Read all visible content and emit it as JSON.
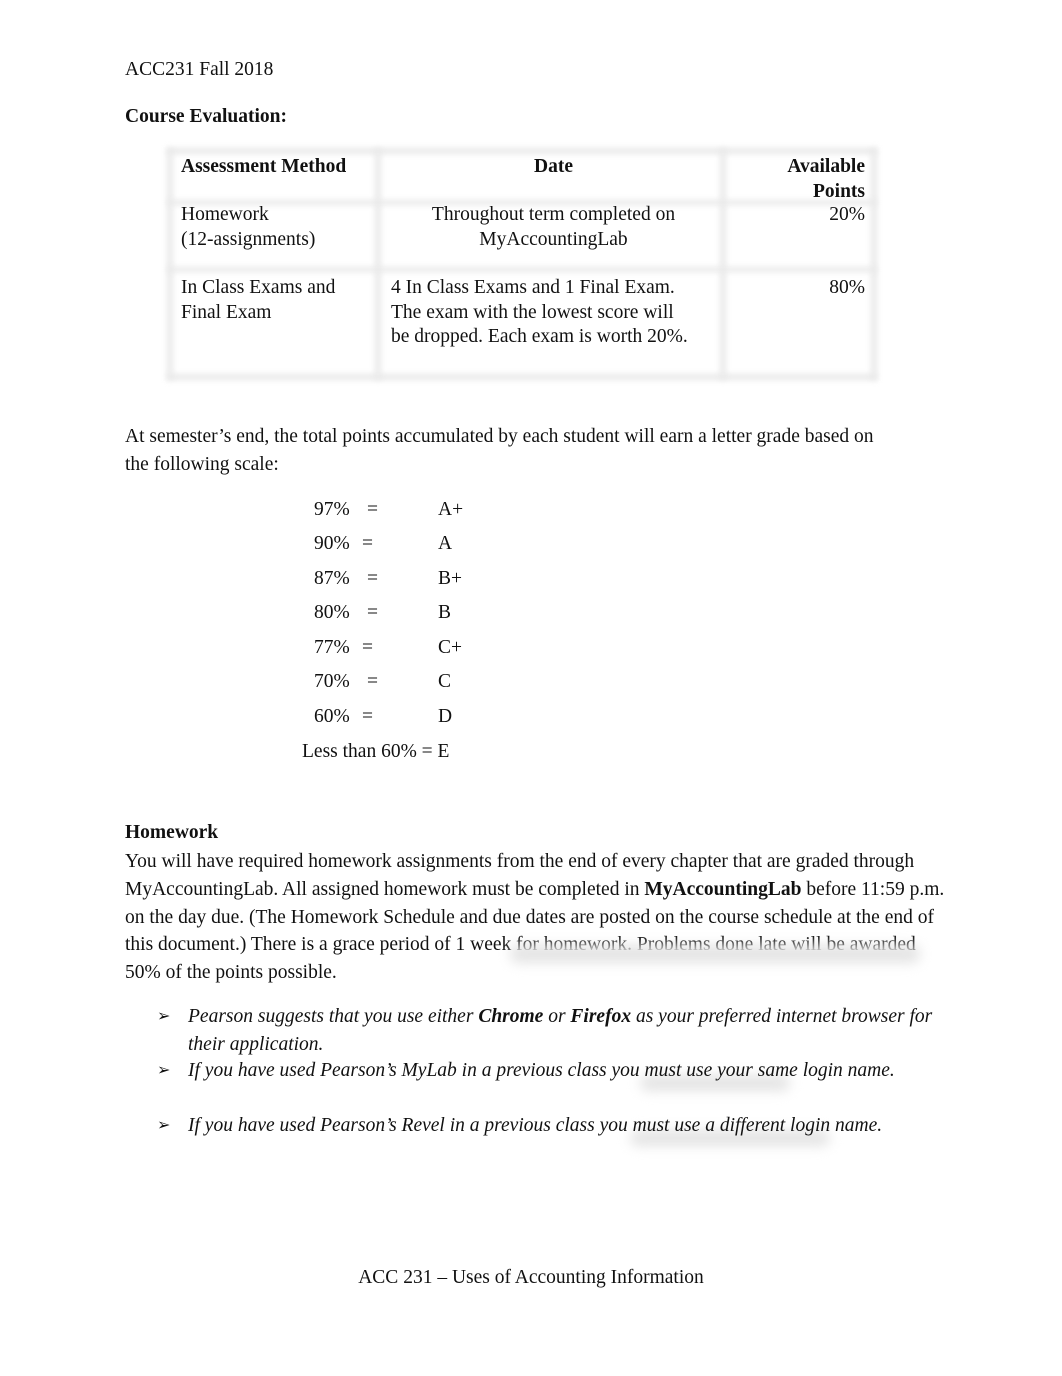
{
  "header": {
    "course_term": "ACC231 Fall 2018"
  },
  "course_evaluation": {
    "title": "Course Evaluation:",
    "table": {
      "headers": [
        "Assessment Method",
        "Date",
        "Available Points"
      ],
      "rows": [
        {
          "method": [
            "Homework",
            "(12-assignments)"
          ],
          "date": [
            "Throughout term completed on",
            "MyAccountingLab"
          ],
          "points": "20%"
        },
        {
          "method": [
            "In Class Exams and",
            "Final Exam"
          ],
          "date": [
            "4 In Class Exams and 1 Final Exam.",
            "The exam with the lowest score will",
            "be dropped. Each exam is worth 20%."
          ],
          "points": "80%"
        }
      ]
    }
  },
  "grading": {
    "intro_line1": "At semester’s end, the total points accumulated by each student will earn a letter grade based on",
    "intro_line2": "the following scale:",
    "scale": [
      {
        "percent": "97%",
        "equals": "=",
        "grade": "A+"
      },
      {
        "percent": "90%",
        "equals": "=",
        "grade": "A"
      },
      {
        "percent": "87%",
        "equals": "=",
        "grade": "B+"
      },
      {
        "percent": "80%",
        "equals": "=",
        "grade": "B"
      },
      {
        "percent": "77%",
        "equals": "=",
        "grade": "C+"
      },
      {
        "percent": "70%",
        "equals": "=",
        "grade": "C"
      },
      {
        "percent": "60%",
        "equals": "=",
        "grade": "D"
      }
    ],
    "last_line": "Less than 60% = E"
  },
  "homework": {
    "title": "Homework",
    "text_part1": "You will have required homework assignments from the end of every chapter that are graded through MyAccountingLab. All assigned homework must be completed in ",
    "text_bold": "MyAccountingLab",
    "text_part2": " before 11:59 p.m. on the day due. (The Homework Schedule and due dates are posted on the course schedule at the end of this document.) There is a grace period of 1 week for homework. Problems done late will be awarded 50% of the points possible.",
    "bullets": [
      {
        "pre": "Pearson suggests that you use either ",
        "bold1": "Chrome",
        "mid": " or ",
        "bold2": "Firefox",
        "post": " as your preferred internet browser for their application."
      },
      {
        "text": "If you have used Pearson’s MyLab in a previous class you must use your same login name."
      },
      {
        "text": "If you have used Pearson’s Revel in a previous class you must use a different login name."
      }
    ],
    "bullet_icon": "arrow-bullet-icon",
    "bullet_glyph": "➢"
  },
  "footer": {
    "text": "ACC 231 – Uses of Accounting Information"
  }
}
